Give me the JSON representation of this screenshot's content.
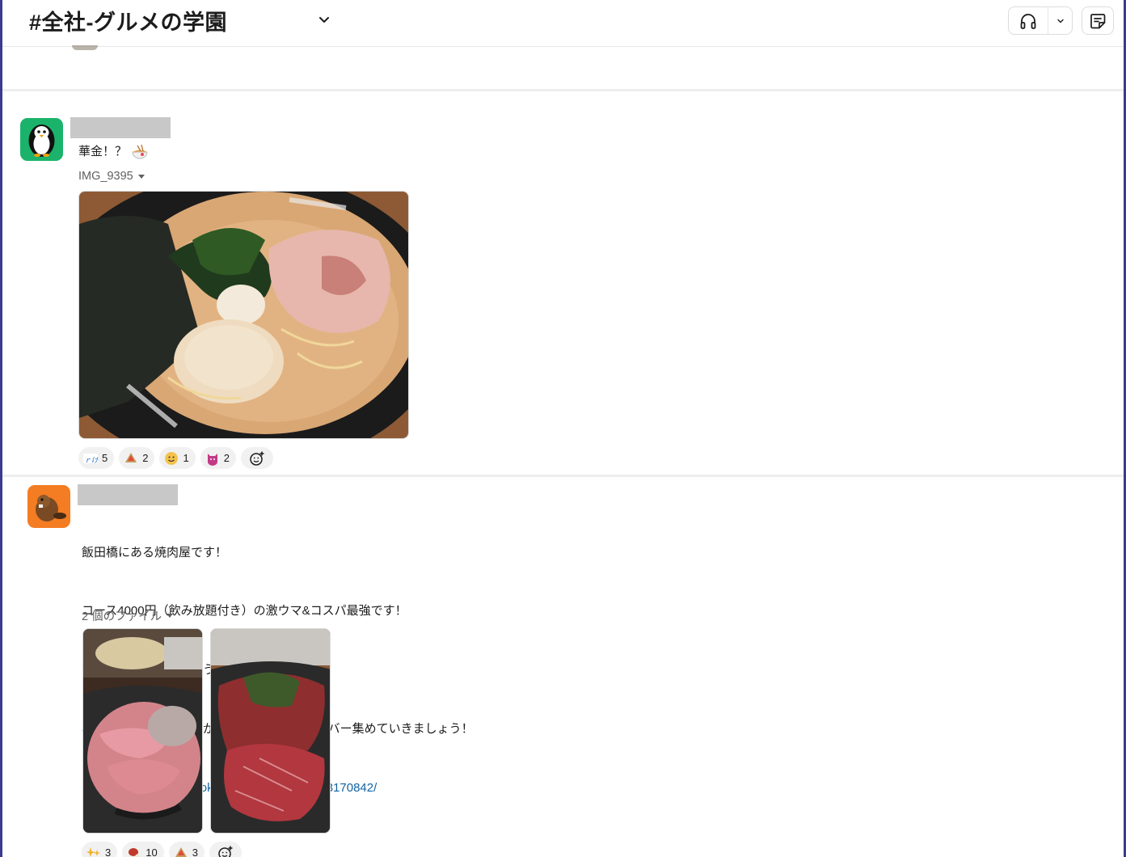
{
  "header": {
    "channel_title": "#全社-グルメの学園"
  },
  "messages": [
    {
      "text_lines": [
        "華金！？"
      ],
      "file_label": "IMG_9395",
      "reactions": [
        {
          "emoji": "yay",
          "count": "5"
        },
        {
          "emoji": "onigiri",
          "count": "2"
        },
        {
          "emoji": "smile-face",
          "count": "1"
        },
        {
          "emoji": "cat-face",
          "count": "2"
        }
      ]
    },
    {
      "text_lines": [
        "飯田橋にある焼肉屋です！",
        "コース4000円（飲み放題付き）の激ウマ&コスパ最強です！",
        "西川口にも店舗あるようです！",
        "興味あるけど行く機会がないって方はY'sメンバー集めていきましょう！"
      ],
      "link": "https://s.tabelog.com/tokyo/A1309/A130905/13170842/",
      "file_label": "2 個のファイル",
      "reactions": [
        {
          "emoji": "sparkles",
          "count": "3"
        },
        {
          "emoji": "meat",
          "count": "10"
        },
        {
          "emoji": "onigiri",
          "count": "3"
        }
      ]
    }
  ]
}
